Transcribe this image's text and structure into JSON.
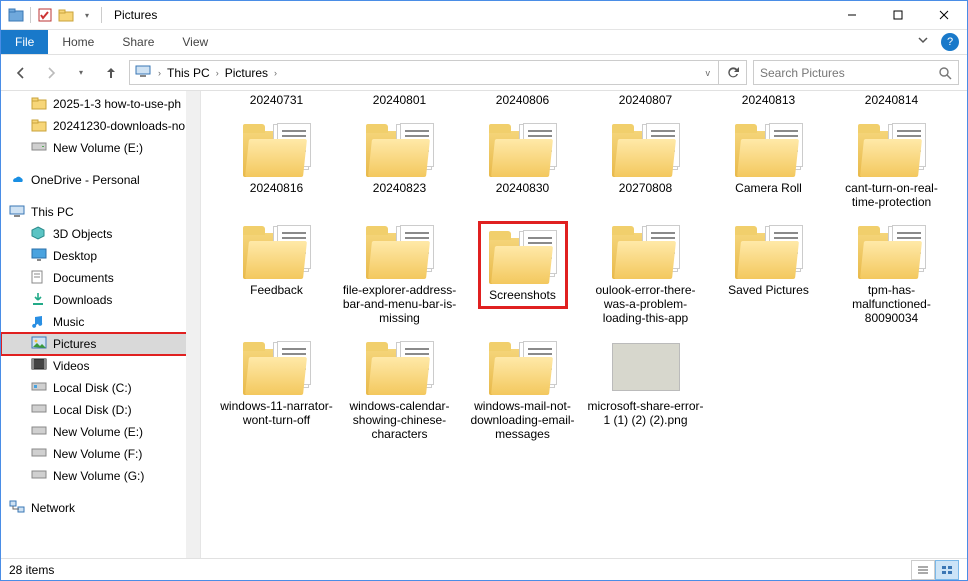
{
  "window": {
    "title": "Pictures"
  },
  "ribbon": {
    "file": "File",
    "tabs": [
      "Home",
      "Share",
      "View"
    ]
  },
  "address": {
    "segments": [
      "This PC",
      "Pictures"
    ]
  },
  "search": {
    "placeholder": "Search Pictures"
  },
  "sidebar": {
    "top_folders": [
      "2025-1-3 how-to-use-ph",
      "20241230-downloads-no",
      "New Volume (E:)"
    ],
    "onedrive": "OneDrive - Personal",
    "thispc": "This PC",
    "thispc_children": [
      "3D Objects",
      "Desktop",
      "Documents",
      "Downloads",
      "Music",
      "Pictures",
      "Videos",
      "Local Disk (C:)",
      "Local Disk (D:)",
      "New Volume (E:)",
      "New Volume (F:)",
      "New Volume (G:)"
    ],
    "network": "Network"
  },
  "items_row0": [
    "20240731",
    "20240801",
    "20240806",
    "20240807",
    "20240813",
    "20240814"
  ],
  "items": [
    {
      "label": "20240816"
    },
    {
      "label": "20240823"
    },
    {
      "label": "20240830"
    },
    {
      "label": "20270808"
    },
    {
      "label": "Camera Roll"
    },
    {
      "label": "cant-turn-on-real-time-protection"
    },
    {
      "label": "Feedback"
    },
    {
      "label": "file-explorer-address-bar-and-menu-bar-is-missing"
    },
    {
      "label": "Screenshots",
      "highlight": true
    },
    {
      "label": "oulook-error-there-was-a-problem-loading-this-app"
    },
    {
      "label": "Saved Pictures"
    },
    {
      "label": "tpm-has-malfunctioned-80090034"
    },
    {
      "label": "windows-11-narrator-wont-turn-off"
    },
    {
      "label": "windows-calendar-showing-chinese-characters"
    },
    {
      "label": "windows-mail-not-downloading-email-messages"
    },
    {
      "label": "microsoft-share-error-1 (1) (2) (2).png",
      "image": true
    }
  ],
  "status": {
    "count_label": "28 items"
  }
}
